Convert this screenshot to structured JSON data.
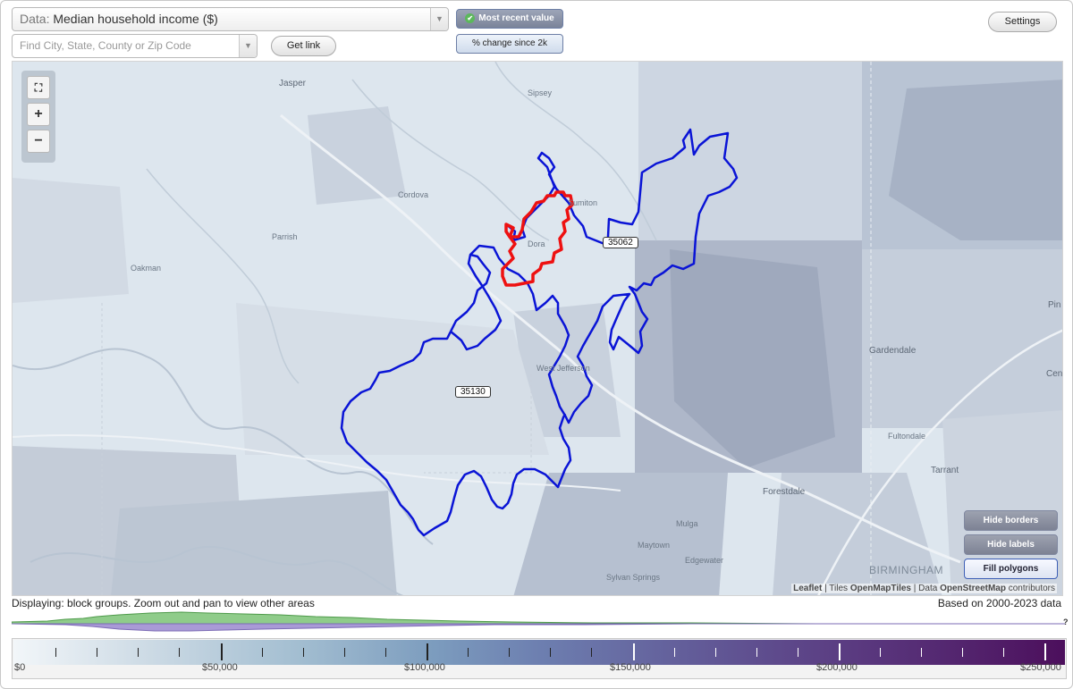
{
  "toolbar": {
    "data_prefix": "Data:",
    "data_value": "Median household income ($)",
    "search_placeholder": "Find City, State, County or Zip Code",
    "get_link": "Get link",
    "most_recent": "Most recent value",
    "pct_change": "% change since 2k",
    "settings": "Settings"
  },
  "map": {
    "places": [
      "Jasper",
      "Sipsey",
      "Cordova",
      "Dora",
      "Sumiton",
      "Parrish",
      "Oakman",
      "West Jefferson",
      "Gardendale",
      "Pin",
      "Center",
      "Fultondale",
      "Tarrant",
      "Forestdale",
      "Mulga",
      "Maytown",
      "Edgewater",
      "Sylvan Springs",
      "BIRMINGHAM"
    ],
    "zip_labels": [
      "35062",
      "35130"
    ],
    "buttons": {
      "hide_borders": "Hide borders",
      "hide_labels": "Hide labels",
      "fill_polygons": "Fill polygons"
    },
    "attribution": {
      "leaflet": "Leaflet",
      "tiles_prefix": "| Tiles",
      "tiles": "OpenMapTiles",
      "data_prefix": "| Data",
      "data": "OpenStreetMap",
      "suffix": "contributors"
    },
    "colors": {
      "zip_border": "#0a14d6",
      "city_border": "#ee1111"
    }
  },
  "footer": {
    "displaying": "Displaying: block groups. Zoom out and pan to view other areas",
    "based_on": "Based on 2000-2023 data",
    "histogram_help": "?"
  },
  "legend": {
    "labels": [
      "$0",
      "$50,000",
      "$100,000",
      "$150,000",
      "$200,000",
      "$250,000"
    ],
    "gradient_start": "#f2f6f9",
    "gradient_end": "#4c0f5c"
  }
}
